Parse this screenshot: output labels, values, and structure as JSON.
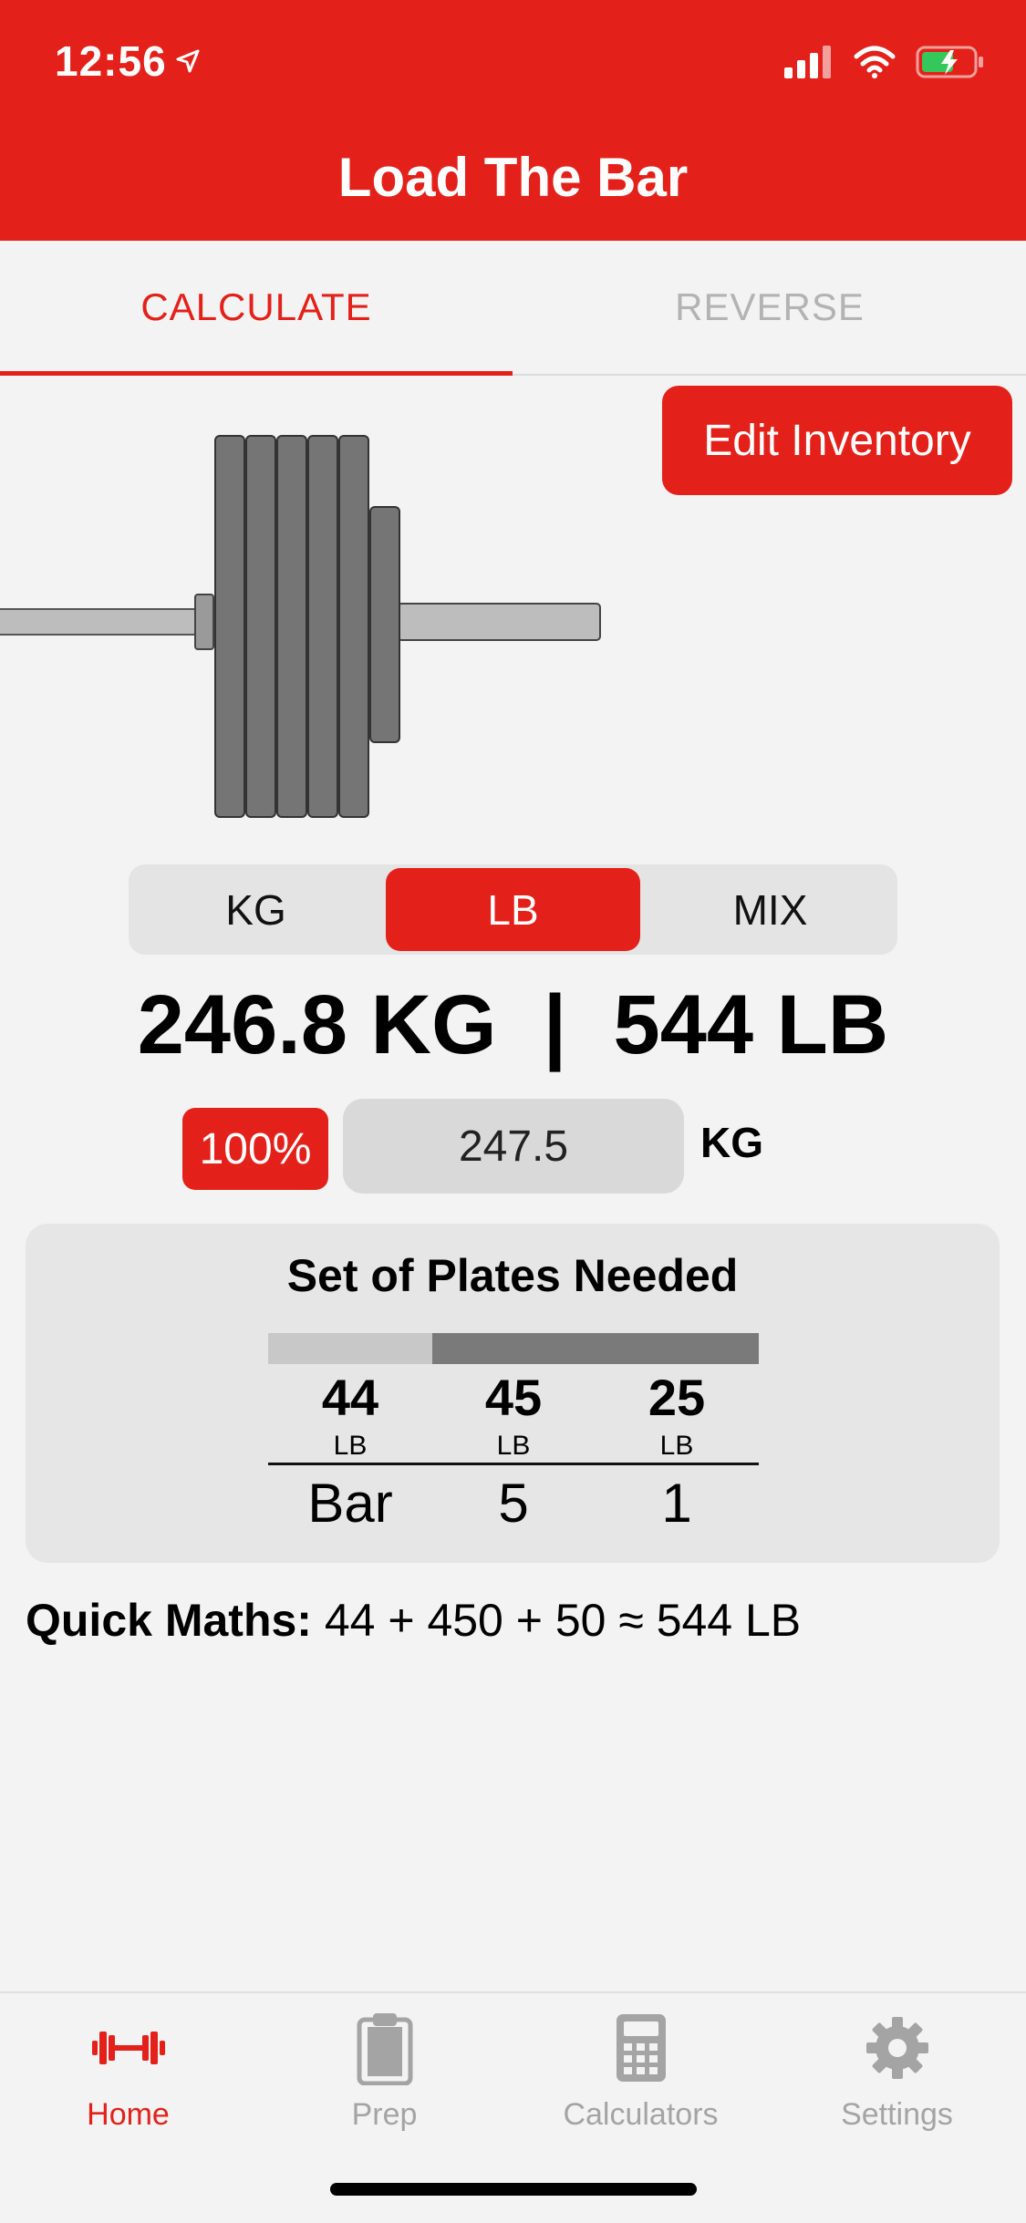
{
  "status_bar": {
    "time": "12:56"
  },
  "header": {
    "title": "Load The Bar"
  },
  "tabs": [
    {
      "label": "CALCULATE",
      "active": true
    },
    {
      "label": "REVERSE",
      "active": false
    }
  ],
  "edit_inventory_label": "Edit Inventory",
  "unit_selector": {
    "options": [
      "KG",
      "LB",
      "MIX"
    ],
    "selected": "LB"
  },
  "total_weight": "246.8 KG  |  544 LB",
  "percent_button": "100%",
  "weight_input": {
    "value": "247.5",
    "unit": "KG"
  },
  "plates_card": {
    "title": "Set of Plates Needed",
    "columns": [
      {
        "value": "44",
        "unit": "LB",
        "count": "Bar"
      },
      {
        "value": "45",
        "unit": "LB",
        "count": "5"
      },
      {
        "value": "25",
        "unit": "LB",
        "count": "1"
      }
    ]
  },
  "quick_maths": {
    "label": "Quick Maths:",
    "expression": " 44 + 450 + 50 ≈ 544 LB"
  },
  "tab_bar": {
    "items": [
      {
        "label": "Home",
        "icon": "barbell-icon",
        "active": true
      },
      {
        "label": "Prep",
        "icon": "clipboard-icon",
        "active": false
      },
      {
        "label": "Calculators",
        "icon": "calculator-icon",
        "active": false
      },
      {
        "label": "Settings",
        "icon": "gear-icon",
        "active": false
      }
    ]
  },
  "colors": {
    "accent": "#e3211a",
    "background": "#f2f3f2",
    "inactive": "#a4a4a4"
  }
}
